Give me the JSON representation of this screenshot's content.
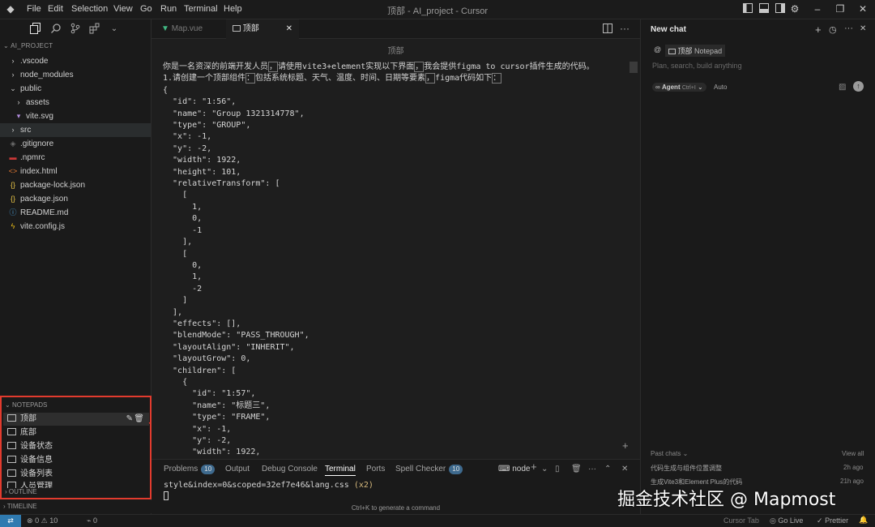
{
  "titlebar": {
    "menu": [
      "File",
      "Edit",
      "Selection",
      "View",
      "Go",
      "Run",
      "Terminal",
      "Help"
    ],
    "title": "顶部 - AI_project - Cursor"
  },
  "explorer": {
    "project": "AI_PROJECT",
    "items": [
      {
        "label": ".vscode",
        "icon": "chevron-right-icon"
      },
      {
        "label": "node_modules",
        "icon": "chevron-right-icon"
      },
      {
        "label": "public",
        "icon": "chevron-down-icon"
      },
      {
        "label": "assets",
        "icon": "chevron-right-icon"
      },
      {
        "label": "vite.svg",
        "icon": "svg-file-icon"
      },
      {
        "label": "src",
        "icon": "chevron-right-icon"
      },
      {
        "label": ".gitignore",
        "icon": "git-file-icon"
      },
      {
        "label": ".npmrc",
        "icon": "npm-file-icon"
      },
      {
        "label": "index.html",
        "icon": "html-file-icon"
      },
      {
        "label": "package-lock.json",
        "icon": "json-file-icon"
      },
      {
        "label": "package.json",
        "icon": "json-file-icon"
      },
      {
        "label": "README.md",
        "icon": "info-file-icon"
      },
      {
        "label": "vite.config.js",
        "icon": "vite-file-icon"
      }
    ]
  },
  "notepads": {
    "heading": "NOTEPADS",
    "items": [
      "顶部",
      "底部",
      "设备状态",
      "设备信息",
      "设备列表",
      "人员管理"
    ],
    "outline": "OUTLINE",
    "timeline": "TIMELINE"
  },
  "tabs": [
    {
      "label": "Map.vue",
      "icon": "vue-file-icon"
    },
    {
      "label": "顶部",
      "icon": "notepad-icon"
    }
  ],
  "editor": {
    "breadcrumb": "顶部",
    "line1_a": "你是一名资深的前端开发人员",
    "line1_b": "，",
    "line1_c": "请使用vite3+element实现以下界面",
    "line1_d": "，",
    "line1_e": "我会提供figma to cursor插件生成的代码。",
    "line2_a": "1.请创建一个顶部组件",
    "line2_b": "：",
    "line2_c": "包括系统标题、天气、温度、时间、日期等要素",
    "line2_d": "，",
    "line2_e": "figma代码如下",
    "line2_f": "：",
    "code_lines": [
      "{",
      "  \"id\": \"1:56\",",
      "  \"name\": \"Group 1321314778\",",
      "  \"type\": \"GROUP\",",
      "  \"x\": -1,",
      "  \"y\": -2,",
      "  \"width\": 1922,",
      "  \"height\": 101,",
      "  \"relativeTransform\": [",
      "    [",
      "      1,",
      "      0,",
      "      -1",
      "    ],",
      "    [",
      "      0,",
      "      1,",
      "      -2",
      "    ]",
      "  ],",
      "  \"effects\": [],",
      "  \"blendMode\": \"PASS_THROUGH\",",
      "  \"layoutAlign\": \"INHERIT\",",
      "  \"layoutGrow\": 0,",
      "  \"children\": [",
      "    {",
      "      \"id\": \"1:57\",",
      "      \"name\": \"标题三\",",
      "      \"type\": \"FRAME\",",
      "      \"x\": -1,",
      "      \"y\": -2,",
      "      \"width\": 1922,"
    ]
  },
  "panel": {
    "tabs": [
      "Problems",
      "Output",
      "Debug Console",
      "Terminal",
      "Ports",
      "Spell Checker"
    ],
    "problems_count": "10",
    "spell_count": "10",
    "shell": "node",
    "terminal_line": "style&index=0&scoped=32ef7e46&lang.css",
    "terminal_suffix": "(x2)",
    "hint": "Ctrl+K to generate a command"
  },
  "chat": {
    "title": "New chat",
    "context_chip": "顶部",
    "context_sub": "Notepad",
    "placeholder": "Plan, search, build anything",
    "mode": "Agent",
    "mode_shortcut": "Ctrl+I",
    "model": "Auto",
    "past_label": "Past chats",
    "view_all": "View all",
    "past": [
      {
        "title": "代码生成与组件位置调整",
        "time": "2h ago"
      },
      {
        "title": "生成Vite3和Element Plus的代码",
        "time": "21h ago"
      }
    ]
  },
  "statusbar": {
    "errors": "0",
    "warnings": "10",
    "ports": "0",
    "items": [
      "Cursor Tab",
      "Go Live",
      "Prettier"
    ]
  },
  "watermark": "掘金技术社区 @ Mapmost",
  "colors": {
    "highlight_box": "#e23b2e",
    "accent_remote": "#2f7ab0"
  }
}
